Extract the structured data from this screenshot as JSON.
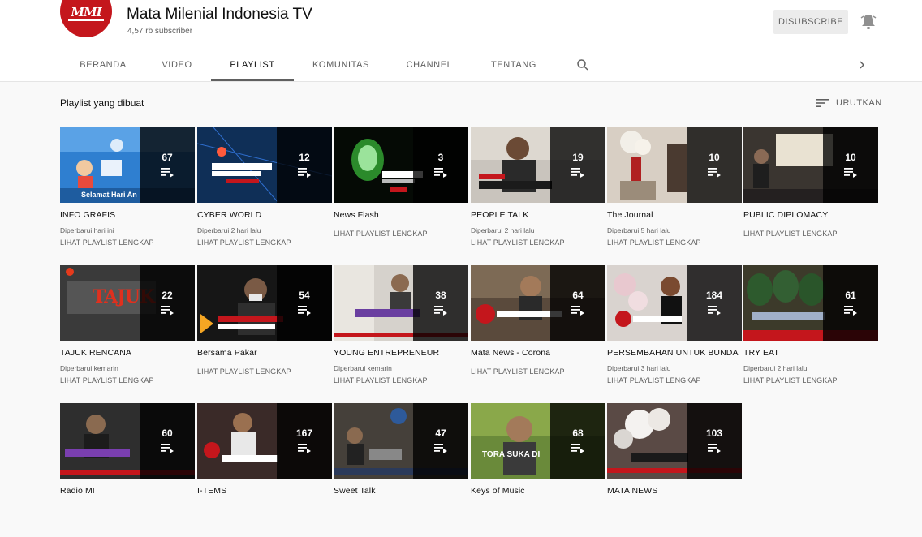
{
  "channel": {
    "title": "Mata Milenial Indonesia TV",
    "subscribers": "4,57 rb subscriber",
    "unsubscribe_label": "DISUBSCRIBE",
    "avatar_text": "MMI"
  },
  "tabs": [
    {
      "label": "BERANDA",
      "active": false
    },
    {
      "label": "VIDEO",
      "active": false
    },
    {
      "label": "PLAYLIST",
      "active": true
    },
    {
      "label": "KOMUNITAS",
      "active": false
    },
    {
      "label": "CHANNEL",
      "active": false
    },
    {
      "label": "TENTANG",
      "active": false
    }
  ],
  "section": {
    "title": "Playlist yang dibuat",
    "sort_label": "URUTKAN"
  },
  "playlists": [
    {
      "title": "INFO GRAFIS",
      "count": "67",
      "updated": "Diperbarui hari ini",
      "link": "LIHAT PLAYLIST LENGKAP",
      "thumb_caption": "Selamat Hari An"
    },
    {
      "title": "CYBER WORLD",
      "count": "12",
      "updated": "Diperbarui 2 hari lalu",
      "link": "LIHAT PLAYLIST LENGKAP",
      "thumb_caption": ""
    },
    {
      "title": "News Flash",
      "count": "3",
      "updated": "",
      "link": "LIHAT PLAYLIST LENGKAP",
      "thumb_caption": ""
    },
    {
      "title": "PEOPLE TALK",
      "count": "19",
      "updated": "Diperbarui 2 hari lalu",
      "link": "LIHAT PLAYLIST LENGKAP",
      "thumb_caption": ""
    },
    {
      "title": "The Journal",
      "count": "10",
      "updated": "Diperbarui 5 hari lalu",
      "link": "LIHAT PLAYLIST LENGKAP",
      "thumb_caption": ""
    },
    {
      "title": "PUBLIC DIPLOMACY",
      "count": "10",
      "updated": "",
      "link": "LIHAT PLAYLIST LENGKAP",
      "thumb_caption": ""
    },
    {
      "title": "TAJUK RENCANA",
      "count": "22",
      "updated": "Diperbarui kemarin",
      "link": "LIHAT PLAYLIST LENGKAP",
      "thumb_caption": "TAJUK"
    },
    {
      "title": "Bersama Pakar",
      "count": "54",
      "updated": "",
      "link": "LIHAT PLAYLIST LENGKAP",
      "thumb_caption": ""
    },
    {
      "title": "YOUNG ENTREPRENEUR",
      "count": "38",
      "updated": "Diperbarui kemarin",
      "link": "LIHAT PLAYLIST LENGKAP",
      "thumb_caption": ""
    },
    {
      "title": "Mata News - Corona",
      "count": "64",
      "updated": "",
      "link": "LIHAT PLAYLIST LENGKAP",
      "thumb_caption": ""
    },
    {
      "title": "PERSEMBAHAN UNTUK BUNDA",
      "count": "184",
      "updated": "Diperbarui 3 hari lalu",
      "link": "LIHAT PLAYLIST LENGKAP",
      "thumb_caption": ""
    },
    {
      "title": "TRY EAT",
      "count": "61",
      "updated": "Diperbarui 2 hari lalu",
      "link": "LIHAT PLAYLIST LENGKAP",
      "thumb_caption": ""
    },
    {
      "title": "Radio MI",
      "count": "60",
      "updated": "",
      "link": "",
      "thumb_caption": ""
    },
    {
      "title": "I-TEMS",
      "count": "167",
      "updated": "",
      "link": "",
      "thumb_caption": ""
    },
    {
      "title": "Sweet Talk",
      "count": "47",
      "updated": "",
      "link": "",
      "thumb_caption": ""
    },
    {
      "title": "Keys of Music",
      "count": "68",
      "updated": "",
      "link": "",
      "thumb_caption": "TORA SUKA DI"
    },
    {
      "title": "MATA NEWS",
      "count": "103",
      "updated": "",
      "link": "",
      "thumb_caption": ""
    }
  ],
  "colors": {
    "brand_red": "#c4161c",
    "page_bg": "#f9f9f9",
    "text_secondary": "#606060"
  }
}
